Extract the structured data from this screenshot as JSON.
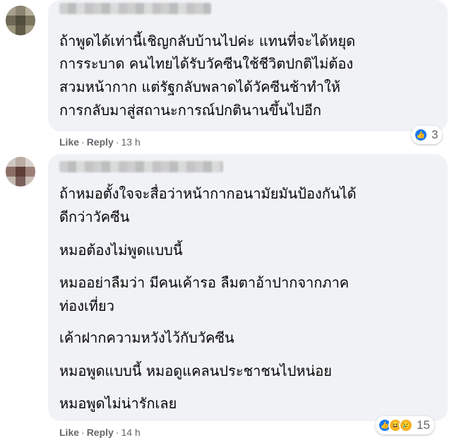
{
  "comments": [
    {
      "text_lines": [
        "ถ้าพูดได้เท่านี้เชิญกลับบ้านไปค่ะ แทนที่จะได้หยุด",
        "การระบาด คนไทยได้รับวัคซีนใช้ชีวิตปกติไม่ต้อง",
        "สวมหน้ากาก แต่รัฐกลับพลาดได้วัคซีนช้าทำให้",
        "การกลับมาสู่สถานะการณ์ปกตินานขึ้นไปอีก"
      ],
      "like_label": "Like",
      "reply_label": "Reply",
      "time": "13 h",
      "reaction_count": "3",
      "reaction_icons": [
        "like-icon"
      ]
    },
    {
      "text_lines": [
        "ถ้าหมอตั้งใจจะสื่อว่าหน้ากากอนามัยมันป้องกันได้",
        "ดีกว่าวัคซีน",
        "หมอต้องไม่พูดแบบนี้",
        "หมออย่าลืมว่า มีคนเค้ารอ ลืมตาอ้าปากจากภาค",
        "ท่องเที่ยว",
        "เค้าฝากความหวังไว้กับวัคซีน",
        "หมอพูดแบบนี้ หมอดูแคลนประชาชนไปหน่อย",
        "หมอพูดไม่น่ารักเลย"
      ],
      "like_label": "Like",
      "reply_label": "Reply",
      "time": "14 h",
      "reaction_count": "15",
      "reaction_icons": [
        "like-icon",
        "haha-icon",
        "sad-icon"
      ]
    }
  ],
  "colors": {
    "bubble": "#f0f2f5",
    "meta_text": "#65676b",
    "like_blue": "#1877f2",
    "emoji_yellow": "#f7b125"
  }
}
